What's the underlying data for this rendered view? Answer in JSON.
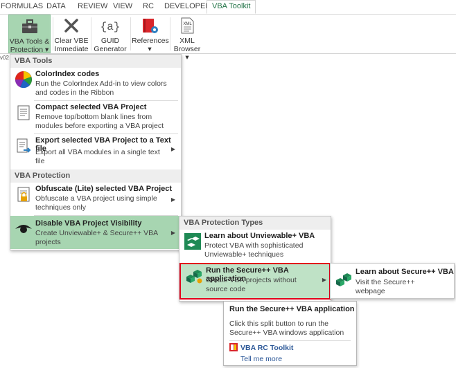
{
  "ribbon_tabs": [
    "FORMULAS",
    "DATA",
    "REVIEW",
    "VIEW",
    "RC",
    "DEVELOPER",
    "VBA Toolkit"
  ],
  "ribbon_buttons": {
    "vba_tools": [
      "VBA Tools &",
      "Protection ▾"
    ],
    "clear_vbe": [
      "Clear VBE",
      "Immediate"
    ],
    "guid": [
      "GUID",
      "Generator ▾"
    ],
    "references": [
      "References",
      "▾"
    ],
    "xml": [
      "XML",
      "Browser ▾"
    ]
  },
  "name_box": "v02",
  "menu": {
    "section_tools": "VBA Tools",
    "colorindex": {
      "title": "ColorIndex codes",
      "desc": "Run the ColorIndex Add-in to view colors and codes in the Ribbon"
    },
    "compact": {
      "title": "Compact selected VBA Project",
      "desc": "Remove top/bottom blank lines from modules before exporting a VBA project"
    },
    "export": {
      "title": "Export selected VBA Project to a Text file",
      "desc": "Export all VBA modules in a single text file"
    },
    "section_protection": "VBA Protection",
    "obfuscate": {
      "title": "Obfuscate (Lite) selected VBA Project",
      "desc": "Obfuscate a VBA project using simple techniques only"
    },
    "disable": {
      "title": "Disable VBA Project Visibility",
      "desc": "Create Unviewable+ & Secure++ VBA projects"
    }
  },
  "submenu": {
    "section": "VBA Protection Types",
    "unviewable": {
      "title": "Learn about Unviewable+ VBA",
      "desc": "Protect VBA with sophisticated Unviewable+ techniques"
    },
    "secure": {
      "title": "Run the Secure++ VBA application",
      "desc": "Create VBA projects without source code"
    }
  },
  "submenu2": {
    "learn_secure": {
      "title": "Learn about Secure++ VBA",
      "desc": "Visit the Secure++ webpage"
    }
  },
  "tooltip": {
    "title": "Run the Secure++ VBA application",
    "body": "Click this split button to run the Secure++ VBA windows application",
    "link_title": "VBA RC Toolkit",
    "link": "Tell me more"
  },
  "colors": {
    "accent": "#217346",
    "highlight": "#a7d5b1",
    "selection_border": "#e3001b"
  }
}
